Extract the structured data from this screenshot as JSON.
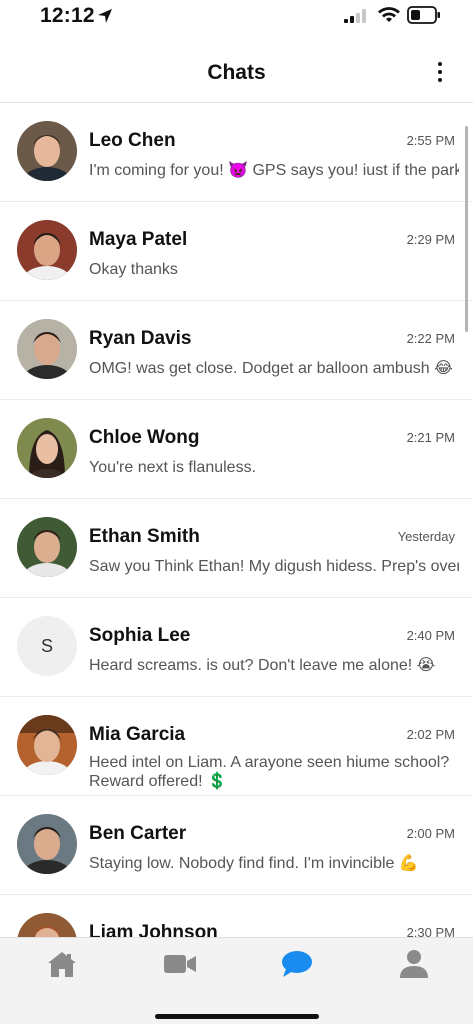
{
  "status_bar": {
    "time": "12:12"
  },
  "header": {
    "title": "Chats"
  },
  "chats": [
    {
      "name": "Leo Chen",
      "time": "2:55 PM",
      "preview": "I'm coming for you! 👿 GPS says you! iust if the park."
    },
    {
      "name": "Maya Patel",
      "time": "2:29 PM",
      "preview": "Okay thanks"
    },
    {
      "name": "Ryan Davis",
      "time": "2:22 PM",
      "preview": "OMG! was get close. Dodget ar balloon ambush 😂"
    },
    {
      "name": "Chloe Wong",
      "time": "2:21 PM",
      "preview": "You're next is flanuless."
    },
    {
      "name": "Ethan Smith",
      "time": "Yesterday",
      "preview": "Saw you Think Ethan! My digush hidess. Prep's over"
    },
    {
      "name": "Sophia Lee",
      "initial": "S",
      "time": "2:40 PM",
      "preview": "Heard screams. is out? Don't leave me alone! 😭"
    },
    {
      "name": "Mia Garcia",
      "time": "2:02 PM",
      "preview": "Heed intel on Liam. A arayone seen hiume school? Reward offered! 💲"
    },
    {
      "name": "Ben Carter",
      "time": "2:00 PM",
      "preview": "Staying low. Nobody find find. I'm invincible 💪"
    },
    {
      "name": "Liam Johnson",
      "time": "2:30 PM",
      "preview": ""
    }
  ],
  "tab_bar": {
    "items": [
      "home-icon",
      "video-icon",
      "chat-bubble-icon",
      "profile-icon"
    ],
    "active": "chat-bubble-icon",
    "active_color": "#1a8cf0",
    "inactive_color": "#8a8a8a"
  }
}
